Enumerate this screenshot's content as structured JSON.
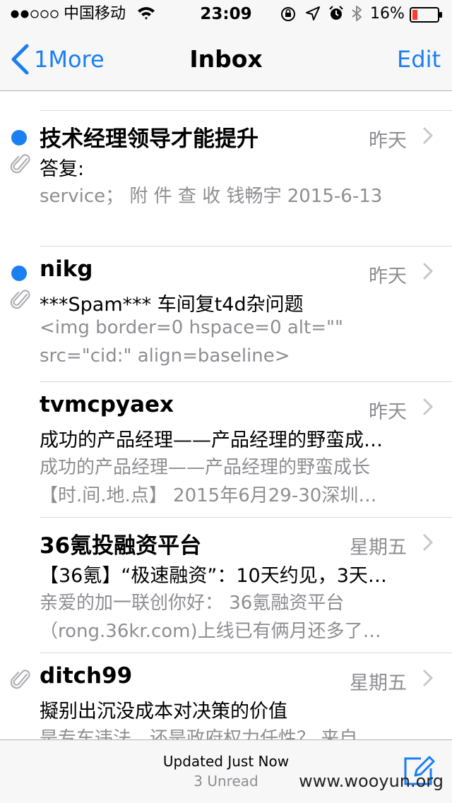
{
  "status_bar": {
    "carrier": "中国移动",
    "time": "23:09",
    "battery": "16%"
  },
  "nav": {
    "back_label": "1More",
    "title": "Inbox",
    "edit_label": "Edit"
  },
  "messages": [
    {
      "sender": "技术经理领导才能提升",
      "date": "昨天",
      "subject": "答复:",
      "preview1": "service；  附 件 查 收 钱畅宇 2015-6-13",
      "preview2": "",
      "unread": true,
      "attachment": true
    },
    {
      "sender": "nikg",
      "date": "昨天",
      "subject": "***Spam*** 车间复t4d杂问题",
      "preview1": "<img border=0 hspace=0 alt=\"\"",
      "preview2": "src=\"cid:\" align=baseline>",
      "unread": true,
      "attachment": true
    },
    {
      "sender": "tvmcpyaex",
      "date": "昨天",
      "subject": "成功的产品经理——产品经理的野蛮成…",
      "preview1": "成功的产品经理——产品经理的野蛮成长",
      "preview2": "【时.间.地.点】 2015年6月29-30深圳…",
      "unread": false,
      "attachment": false
    },
    {
      "sender": "36氪投融资平台",
      "date": "星期五",
      "subject": "【36氪】“极速融资”：10天约见，3天…",
      "preview1": "亲爱的加一联创你好：  36氪融资平台",
      "preview2": "（rong.36kr.com)上线已有俩月还多了…",
      "unread": false,
      "attachment": false
    },
    {
      "sender": "ditch99",
      "date": "星期五",
      "subject": "擬别出沉没成本对决策的价值",
      "preview1": "是专车违法，还是政府权力任性？ 来自",
      "preview2": "",
      "unread": false,
      "attachment": true
    }
  ],
  "toolbar": {
    "updated": "Updated Just Now",
    "unread_count": "3 Unread"
  },
  "watermark": "www.wooyun.org",
  "colors": {
    "accent": "#1a7ff2",
    "secondary_text": "#8e8e93",
    "battery_low": "#ff3b30"
  }
}
